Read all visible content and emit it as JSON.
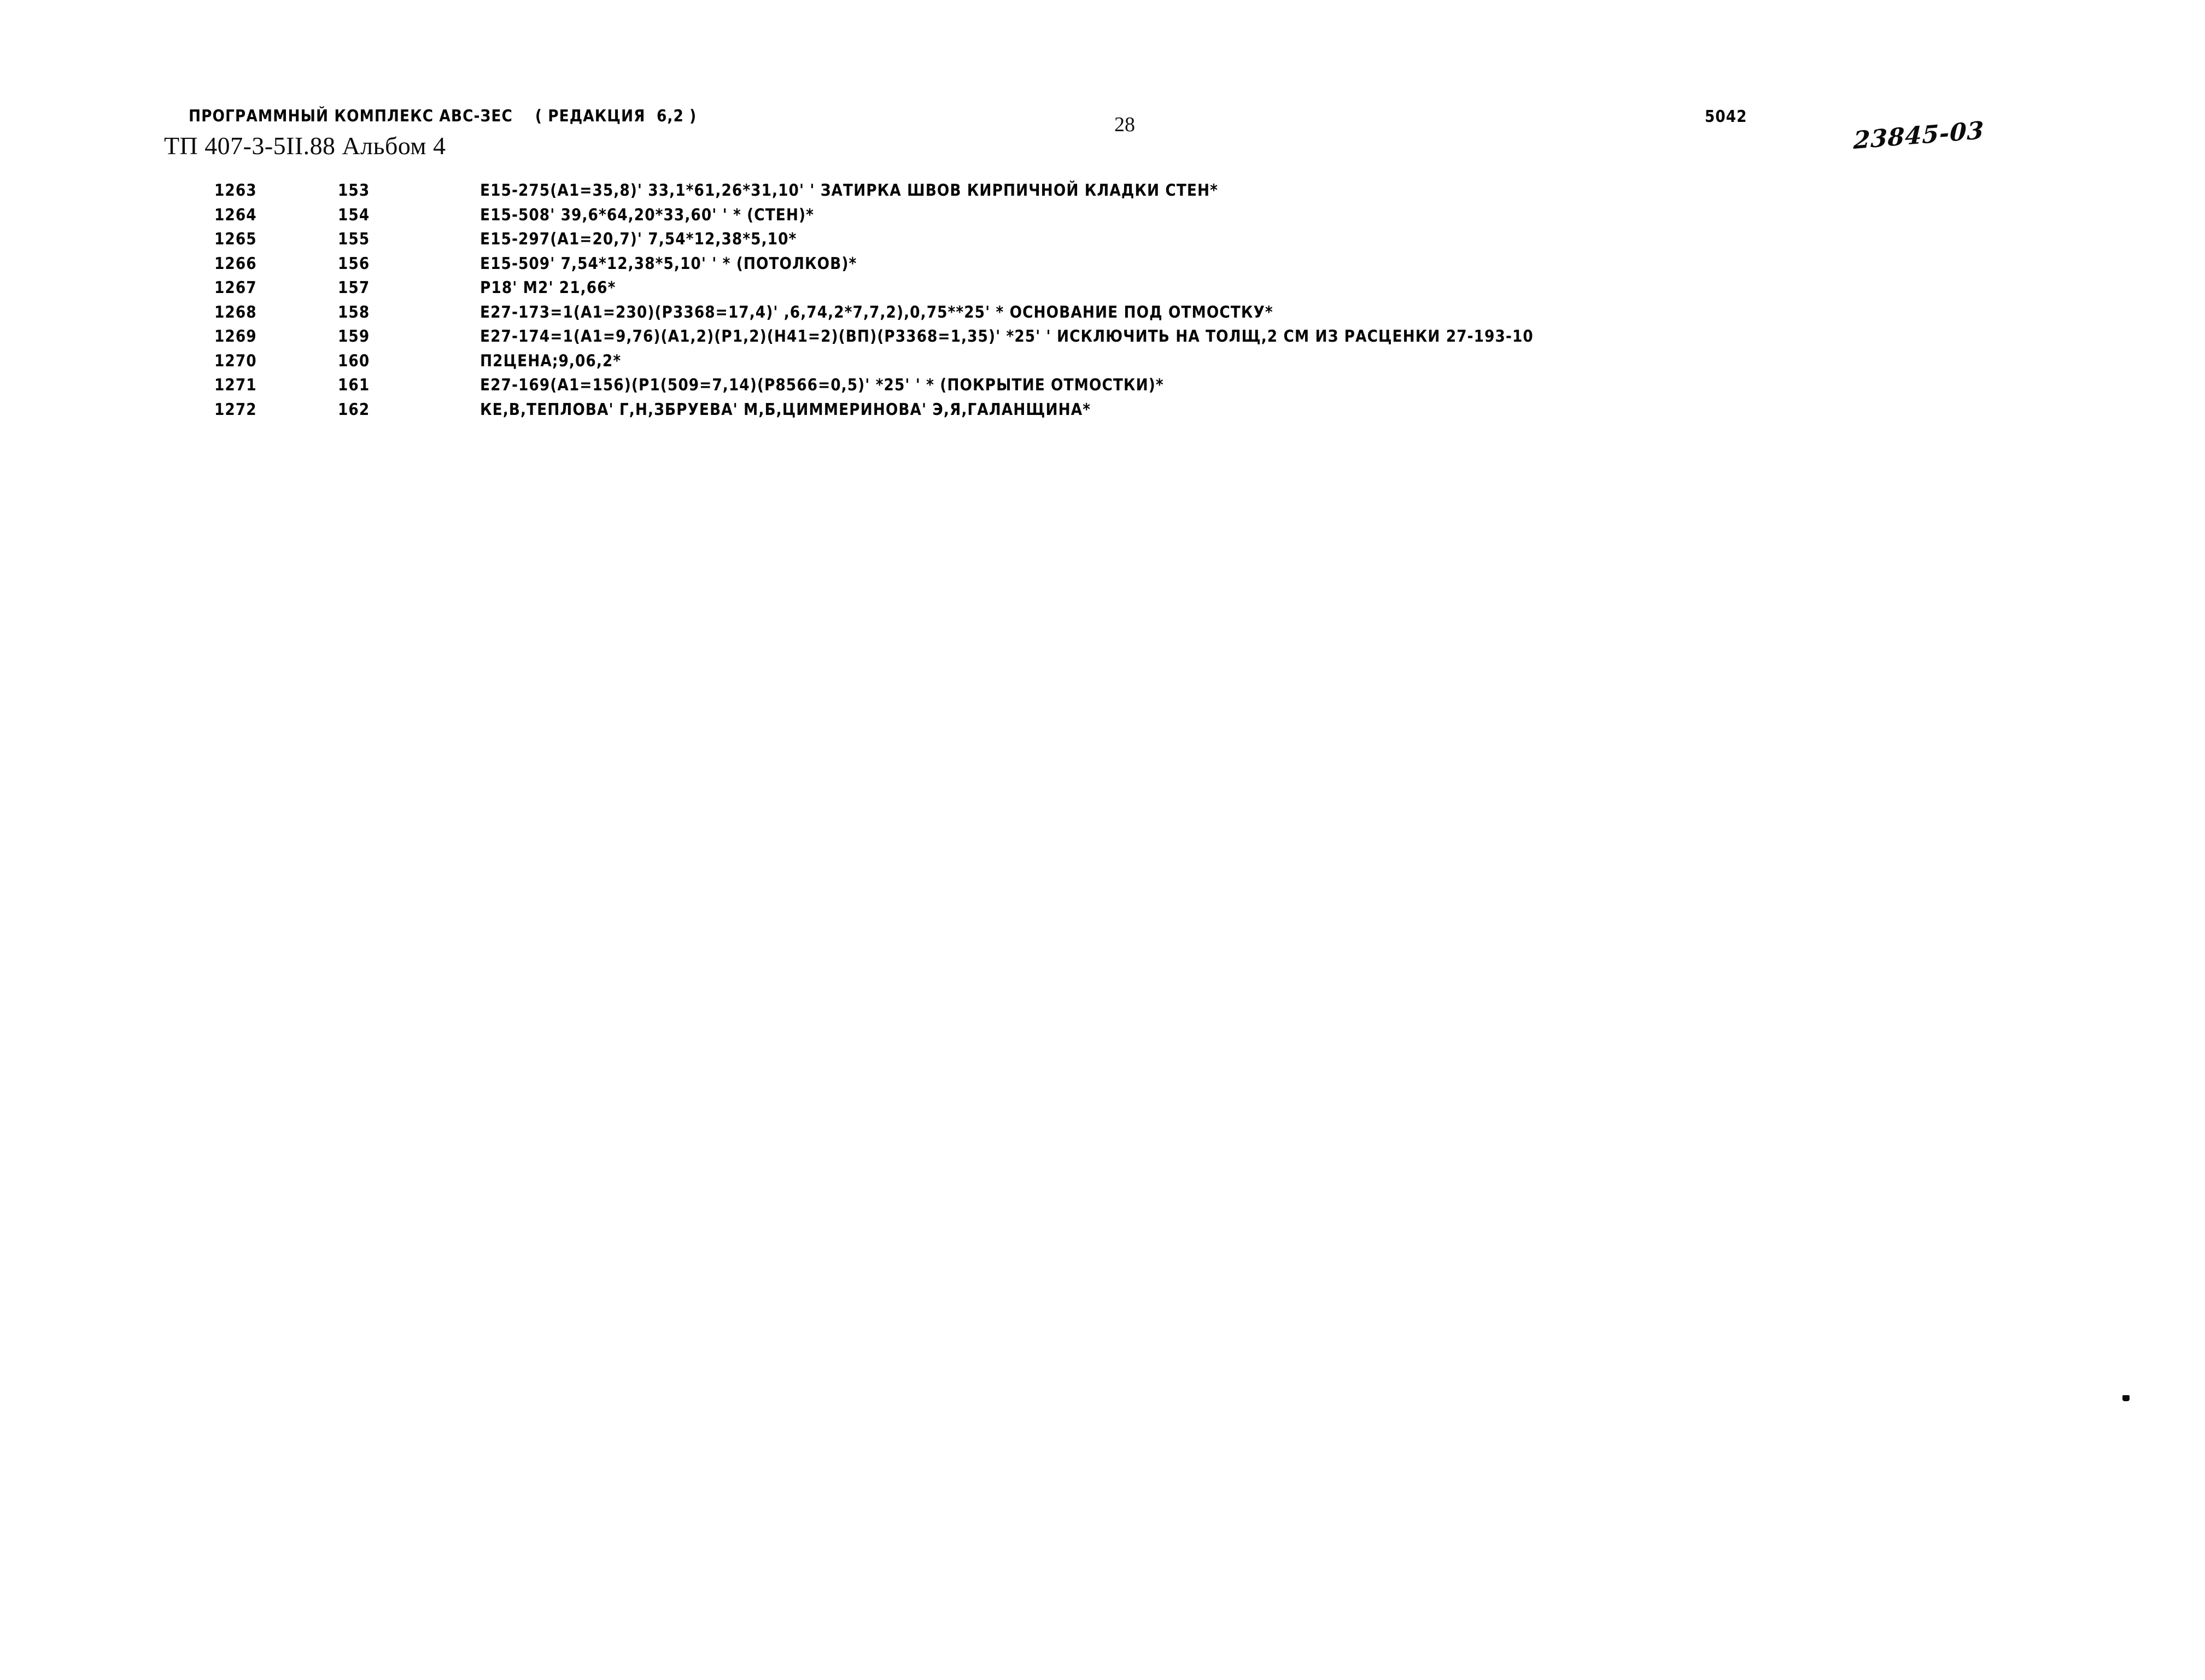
{
  "header": {
    "program_line": "ПРОГРАММНЫЙ КОМПЛЕКС АВС-ЗЕС    ( РЕДАКЦИЯ  6,2 )",
    "album_line": "ТП 407-3-5II.88 Альбом 4",
    "page_number": "28",
    "right_code": "5042",
    "handwritten_archive_number": "23845-03"
  },
  "listing": {
    "columns": [
      "seq",
      "idx",
      "text"
    ],
    "rows": [
      {
        "seq": "1263",
        "idx": "153",
        "text": "E15-275(A1=35,8)' 33,1*61,26*31,10' ' ЗАТИРКА ШВОВ КИРПИЧНОЙ КЛАДКИ СТЕН*"
      },
      {
        "seq": "1264",
        "idx": "154",
        "text": "E15-508' 39,6*64,20*33,60' ' * (СТЕН)*"
      },
      {
        "seq": "1265",
        "idx": "155",
        "text": "E15-297(A1=20,7)' 7,54*12,38*5,10*"
      },
      {
        "seq": "1266",
        "idx": "156",
        "text": "E15-509' 7,54*12,38*5,10' ' * (ПОТОЛКОВ)*"
      },
      {
        "seq": "1267",
        "idx": "157",
        "text": "Р18' М2' 21,66*"
      },
      {
        "seq": "1268",
        "idx": "158",
        "text": "E27-173=1(A1=230)(P3368=17,4)' ,6,74,2*7,7,2),0,75**25' * ОСНОВАНИЕ ПОД ОТМОСТКУ*"
      },
      {
        "seq": "1269",
        "idx": "159",
        "text": "E27-174=1(A1=9,76)(A1,2)(P1,2)(H41=2)(ВП)(P3368=1,35)' *25' ' ИСКЛЮЧИТЬ НА ТОЛЩ,2 СМ ИЗ РАСЦЕНКИ 27-193-10"
      },
      {
        "seq": "1270",
        "idx": "160",
        "text": "П2ЦЕНА;9,06,2*"
      },
      {
        "seq": "1271",
        "idx": "161",
        "text": "E27-169(A1=156)(P1(509=7,14)(P8566=0,5)' *25' ' * (ПОКРЫТИЕ ОТМОСТКИ)*"
      },
      {
        "seq": "1272",
        "idx": "162",
        "text": "КЕ,В,ТЕПЛОВА' Г,Н,ЗБРУЕВА' М,Б,ЦИММЕРИНОВА' Э,Я,ГАЛАНЩИНА*"
      }
    ]
  }
}
